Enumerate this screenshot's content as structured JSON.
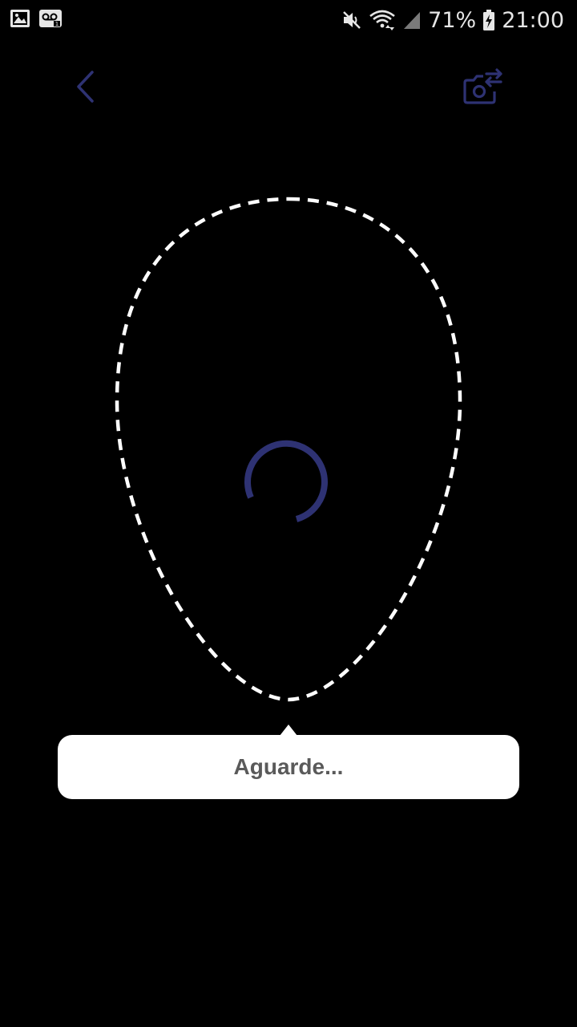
{
  "status_bar": {
    "battery_percent": "71%",
    "time": "21:00",
    "icons": [
      "image-icon",
      "voicemail-icon",
      "mute-icon",
      "wifi-icon",
      "signal-icon",
      "battery-charging-icon"
    ]
  },
  "header": {
    "back_icon": "chevron-left-icon",
    "switch_camera_icon": "camera-switch-icon"
  },
  "accent_color": "#2e3273",
  "face_guide": {
    "style": "dashed-oval",
    "color": "#ffffff"
  },
  "loading": {
    "icon": "loading-spinner-icon"
  },
  "tooltip": {
    "message": "Aguarde..."
  }
}
